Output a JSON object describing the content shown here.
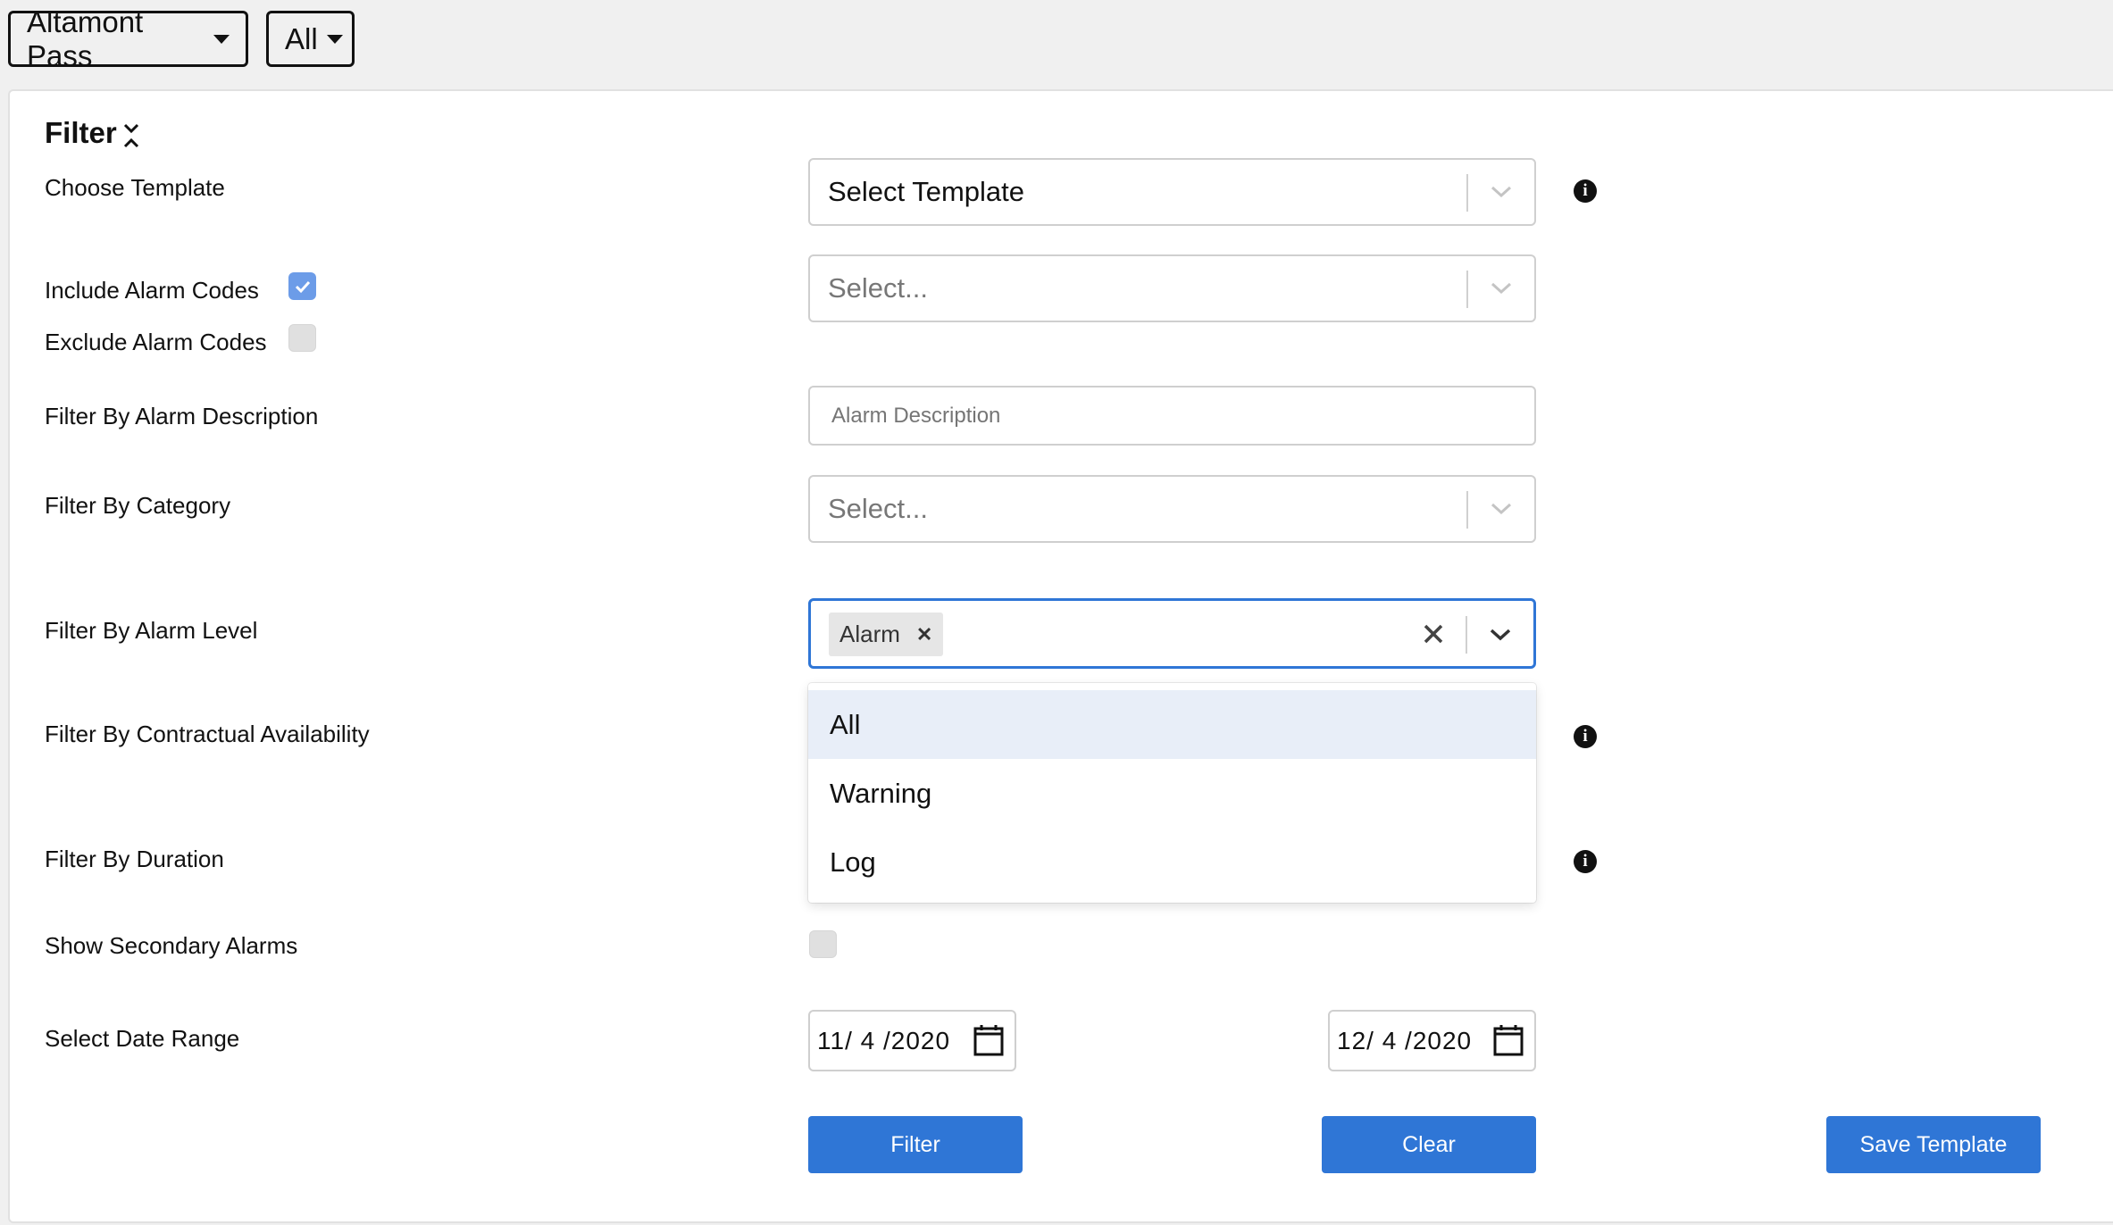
{
  "topbar": {
    "site": "Altamont Pass",
    "scope": "All"
  },
  "filter": {
    "title": "Filter",
    "choose_template": {
      "label": "Choose Template",
      "value": "Select Template"
    },
    "include_alarm_codes": {
      "label": "Include Alarm Codes",
      "checked": true
    },
    "exclude_alarm_codes": {
      "label": "Exclude Alarm Codes",
      "checked": false
    },
    "alarm_codes_select": {
      "placeholder": "Select..."
    },
    "alarm_description": {
      "label": "Filter By Alarm Description",
      "placeholder": "Alarm Description"
    },
    "category": {
      "label": "Filter By Category",
      "placeholder": "Select..."
    },
    "alarm_level": {
      "label": "Filter By Alarm Level",
      "selected_tag": "Alarm",
      "options": [
        "All",
        "Warning",
        "Log"
      ],
      "highlighted": "All"
    },
    "contractual_availability": {
      "label": "Filter By Contractual Availability"
    },
    "duration": {
      "label": "Filter By Duration"
    },
    "secondary_alarms": {
      "label": "Show Secondary Alarms",
      "checked": false
    },
    "date_range": {
      "label": "Select Date Range",
      "start": "11/ 4 /2020",
      "end": "12/ 4 /2020"
    },
    "buttons": {
      "filter": "Filter",
      "clear": "Clear",
      "save_template": "Save Template"
    }
  },
  "colors": {
    "primary": "#2f76d6",
    "focus_border": "#2f76d6",
    "checkbox_on": "#6c9ce8",
    "option_highlight": "#e8eef8"
  }
}
